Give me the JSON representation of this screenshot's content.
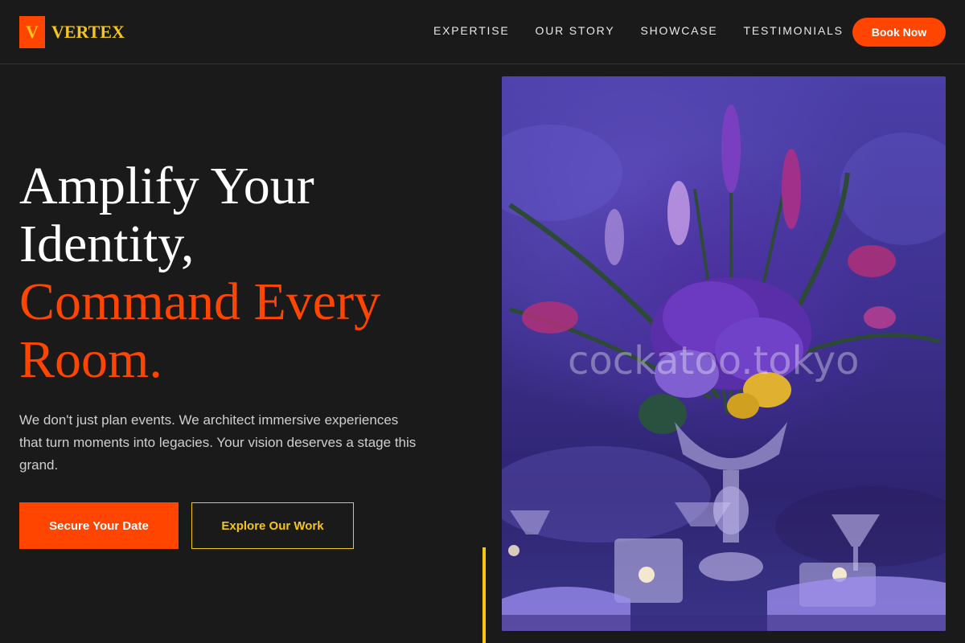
{
  "brand": {
    "mark": "V",
    "name": "VERTEX",
    "colors": {
      "accent": "#ff4500",
      "gold": "#f5c518",
      "background": "#1a1a1a"
    }
  },
  "nav": {
    "items": [
      "EXPERTISE",
      "OUR STORY",
      "SHOWCASE",
      "TESTIMONIALS"
    ],
    "cta": "Book Now"
  },
  "hero": {
    "title_line1": "Amplify Your",
    "title_line2": "Identity,",
    "title_line3": "Command Every",
    "title_line4": "Room.",
    "description": "We don't just plan events. We architect immersive experiences that turn moments into legacies. Your vision deserves a stage this grand.",
    "primary_button": "Secure Your Date",
    "secondary_button": "Explore Our Work",
    "image": {
      "subject": "floral-centerpiece-photo",
      "watermark": "cockatoo.tokyo"
    }
  }
}
